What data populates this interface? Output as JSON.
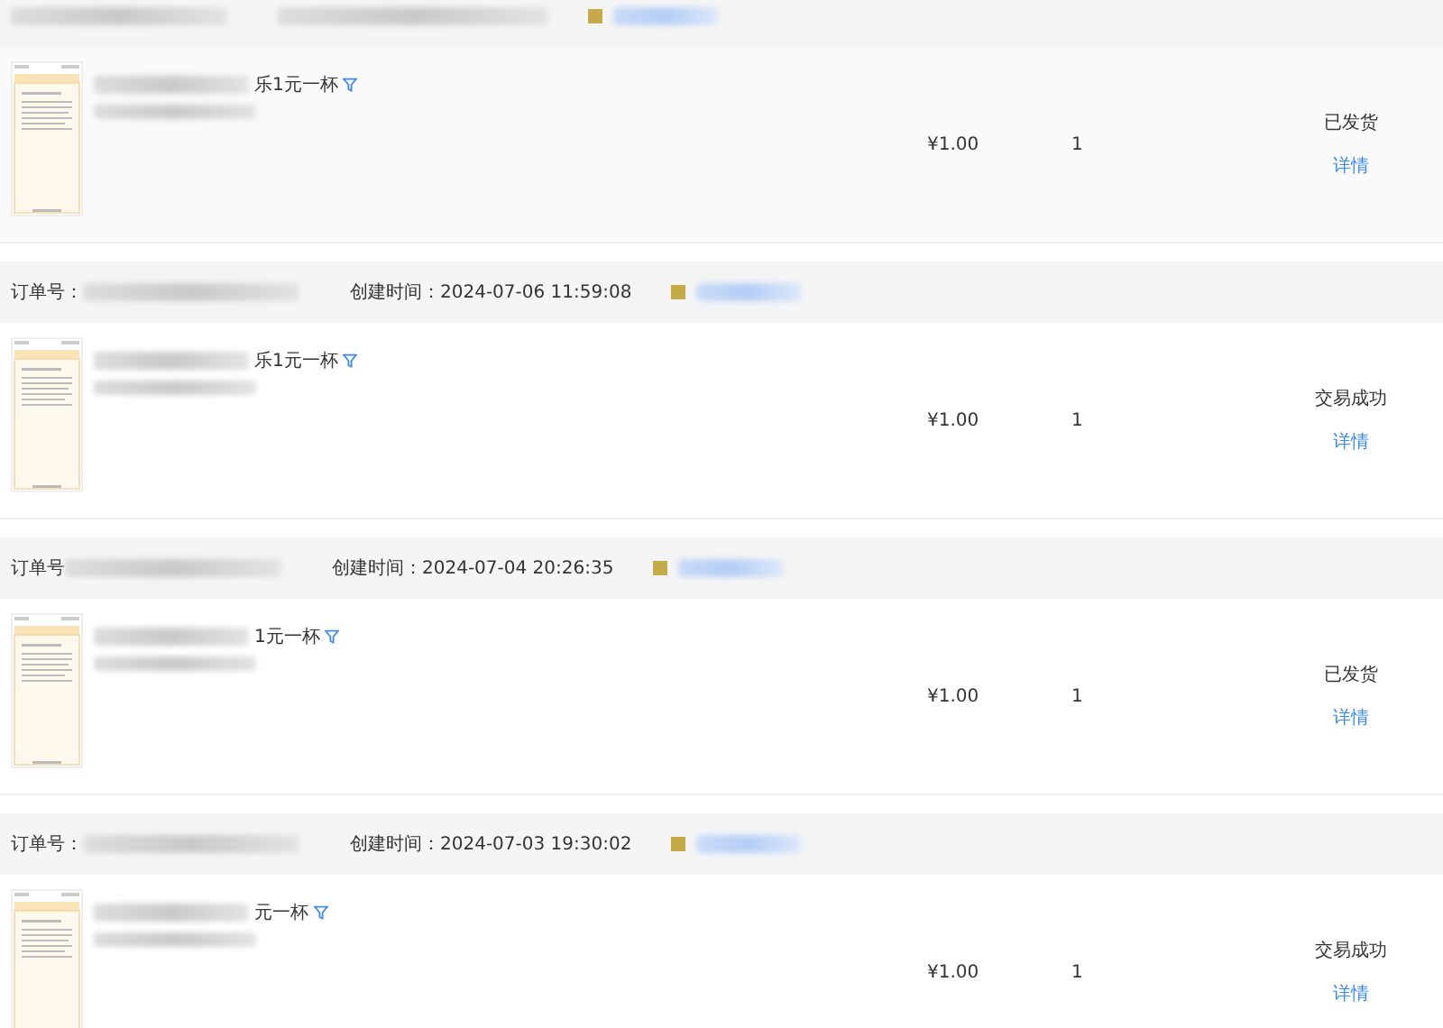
{
  "orders": [
    {
      "title_fragment": "乐1元一杯",
      "price": "¥1.00",
      "quantity": "1",
      "status": "已发货",
      "detail_link": "详情"
    },
    {
      "order_label": "订单号：",
      "created": "创建时间：2024-07-06 11:59:08",
      "title_fragment": "乐1元一杯",
      "price": "¥1.00",
      "quantity": "1",
      "status": "交易成功",
      "detail_link": "详情"
    },
    {
      "order_label": "订单号",
      "created": "创建时间：2024-07-04 20:26:35",
      "title_fragment": "1元一杯",
      "price": "¥1.00",
      "quantity": "1",
      "status": "已发货",
      "detail_link": "详情"
    },
    {
      "order_label": "订单号：",
      "created": "创建时间：2024-07-03 19:30:02",
      "title_fragment": "元一杯",
      "price": "¥1.00",
      "quantity": "1",
      "status": "交易成功",
      "detail_link": "详情"
    }
  ]
}
